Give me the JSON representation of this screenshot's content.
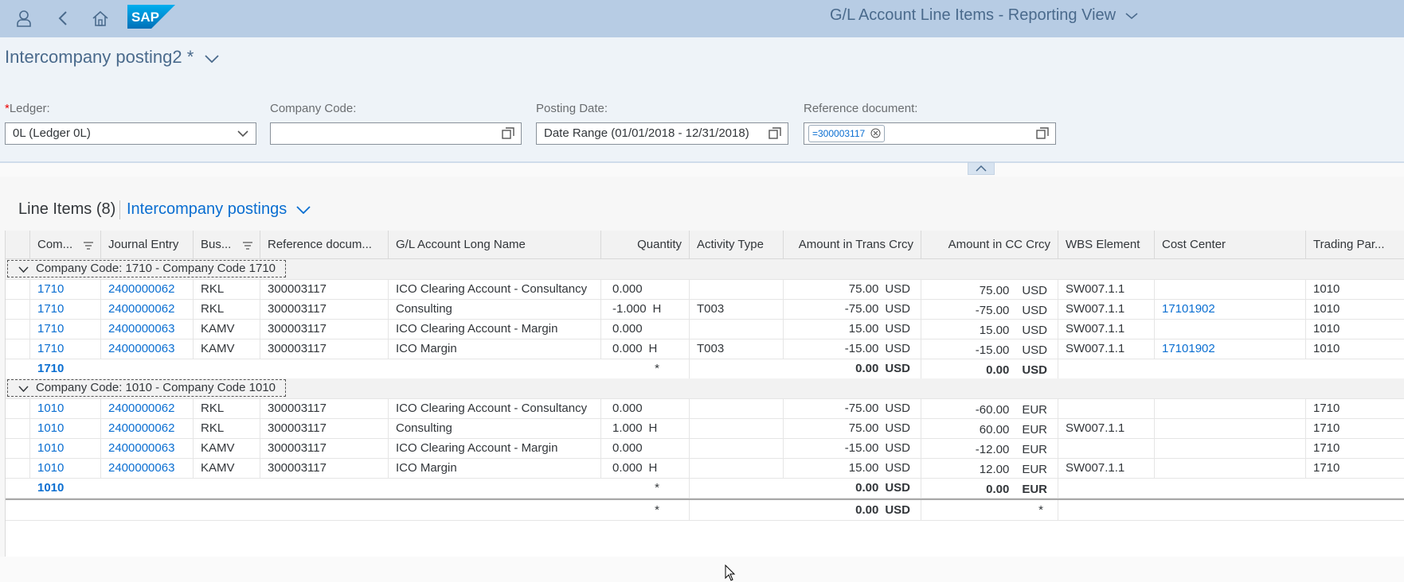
{
  "shell": {
    "title": "G/L Account Line Items - Reporting View",
    "logo_text": "SAP",
    "icons": [
      "user-icon",
      "back-icon",
      "home-icon",
      "sap-logo",
      "title-chevron-icon"
    ]
  },
  "header": {
    "variant_name": "Intercompany posting2 *",
    "filters": [
      {
        "label": "Ledger:",
        "required": true,
        "value": "0L (Ledger 0L)",
        "icon": "chevron-down-icon"
      },
      {
        "label": "Company Code:",
        "required": false,
        "value": "",
        "icon": "value-help-icon"
      },
      {
        "label": "Posting Date:",
        "required": false,
        "value": "Date Range (01/01/2018 - 12/31/2018)",
        "icon": "value-help-icon"
      },
      {
        "label": "Reference document:",
        "required": false,
        "token": "=300003117",
        "icon": "value-help-icon"
      }
    ],
    "required_mark": "*"
  },
  "table": {
    "title": "Line Items (8)",
    "variant": "Intercompany postings",
    "columns": [
      "Com...",
      "Journal Entry",
      "Bus...",
      "Reference docum...",
      "G/L Account Long Name",
      "Quantity",
      "Activity Type",
      "Amount in Trans Crcy",
      "Amount in CC Crcy",
      "WBS Element",
      "Cost Center",
      "Trading Par..."
    ],
    "groups": [
      {
        "label": "Company Code: 1710 - Company Code 1710",
        "rows": [
          {
            "company": "1710",
            "journal": "2400000062",
            "bus": "RKL",
            "ref": "300003117",
            "gl": "ICO Clearing Account - Consultancy",
            "qty": "0.000",
            "qty_unit": "",
            "activity": "",
            "amt_trans": "75.00",
            "trans_cur": "USD",
            "amt_cc": "75.00",
            "cc_cur": "USD",
            "wbs": "SW007.1.1",
            "cost_center": "",
            "trading": "1010"
          },
          {
            "company": "1710",
            "journal": "2400000062",
            "bus": "RKL",
            "ref": "300003117",
            "gl": "Consulting",
            "qty": "-1.000",
            "qty_unit": "H",
            "activity": "T003",
            "amt_trans": "-75.00",
            "trans_cur": "USD",
            "amt_cc": "-75.00",
            "cc_cur": "USD",
            "wbs": "SW007.1.1",
            "cost_center": "17101902",
            "trading": "1010"
          },
          {
            "company": "1710",
            "journal": "2400000063",
            "bus": "KAMV",
            "ref": "300003117",
            "gl": "ICO Clearing Account - Margin",
            "qty": "0.000",
            "qty_unit": "",
            "activity": "",
            "amt_trans": "15.00",
            "trans_cur": "USD",
            "amt_cc": "15.00",
            "cc_cur": "USD",
            "wbs": "SW007.1.1",
            "cost_center": "",
            "trading": "1010"
          },
          {
            "company": "1710",
            "journal": "2400000063",
            "bus": "KAMV",
            "ref": "300003117",
            "gl": "ICO Margin",
            "qty": "0.000",
            "qty_unit": "H",
            "activity": "T003",
            "amt_trans": "-15.00",
            "trans_cur": "USD",
            "amt_cc": "-15.00",
            "cc_cur": "USD",
            "wbs": "SW007.1.1",
            "cost_center": "17101902",
            "trading": "1010"
          }
        ],
        "subtotal": {
          "company": "1710",
          "qty": "*",
          "amt_trans": "0.00",
          "trans_cur": "USD",
          "amt_cc": "0.00",
          "cc_cur": "USD"
        }
      },
      {
        "label": "Company Code: 1010 - Company Code 1010",
        "rows": [
          {
            "company": "1010",
            "journal": "2400000062",
            "bus": "RKL",
            "ref": "300003117",
            "gl": "ICO Clearing Account - Consultancy",
            "qty": "0.000",
            "qty_unit": "",
            "activity": "",
            "amt_trans": "-75.00",
            "trans_cur": "USD",
            "amt_cc": "-60.00",
            "cc_cur": "EUR",
            "wbs": "",
            "cost_center": "",
            "trading": "1710"
          },
          {
            "company": "1010",
            "journal": "2400000062",
            "bus": "RKL",
            "ref": "300003117",
            "gl": "Consulting",
            "qty": "1.000",
            "qty_unit": "H",
            "activity": "",
            "amt_trans": "75.00",
            "trans_cur": "USD",
            "amt_cc": "60.00",
            "cc_cur": "EUR",
            "wbs": "SW007.1.1",
            "cost_center": "",
            "trading": "1710"
          },
          {
            "company": "1010",
            "journal": "2400000063",
            "bus": "KAMV",
            "ref": "300003117",
            "gl": "ICO Clearing Account - Margin",
            "qty": "0.000",
            "qty_unit": "",
            "activity": "",
            "amt_trans": "-15.00",
            "trans_cur": "USD",
            "amt_cc": "-12.00",
            "cc_cur": "EUR",
            "wbs": "",
            "cost_center": "",
            "trading": "1710"
          },
          {
            "company": "1010",
            "journal": "2400000063",
            "bus": "KAMV",
            "ref": "300003117",
            "gl": "ICO Margin",
            "qty": "0.000",
            "qty_unit": "H",
            "activity": "",
            "amt_trans": "15.00",
            "trans_cur": "USD",
            "amt_cc": "12.00",
            "cc_cur": "EUR",
            "wbs": "SW007.1.1",
            "cost_center": "",
            "trading": "1710"
          }
        ],
        "subtotal": {
          "company": "1010",
          "qty": "*",
          "amt_trans": "0.00",
          "trans_cur": "USD",
          "amt_cc": "0.00",
          "cc_cur": "EUR"
        }
      }
    ],
    "grand_total": {
      "qty": "*",
      "amt_trans": "0.00",
      "trans_cur": "USD",
      "amt_cc": "*"
    }
  },
  "colors": {
    "shell_bg": "#b7cce4",
    "header_bg": "#eef3f8",
    "link": "#0a6ed1",
    "text": "#32363a"
  }
}
